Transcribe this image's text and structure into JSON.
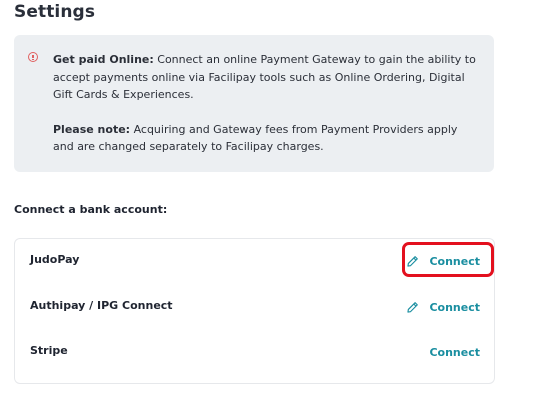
{
  "page": {
    "title": "Settings"
  },
  "info": {
    "line1_bold": "Get paid Online:",
    "line1_text": "Connect an online Payment Gateway to gain the ability to accept payments online via Facilipay tools such as Online Ordering, Digital Gift Cards & Experiences.",
    "line2_bold": "Please note:",
    "line2_text": "Acquiring and Gateway fees from Payment Providers apply and are changed separately to Facilipay charges.",
    "icon": "alert-circle-icon",
    "icon_color": "#e06060"
  },
  "bank": {
    "section_label": "Connect a bank account:",
    "providers": [
      {
        "name": "JudoPay",
        "action": "Connect",
        "icon": "pencil-icon",
        "highlighted": true
      },
      {
        "name": "Authipay / IPG Connect",
        "action": "Connect",
        "icon": "pencil-icon",
        "highlighted": false
      },
      {
        "name": "Stripe",
        "action": "Connect",
        "icon": null,
        "highlighted": false
      }
    ]
  },
  "colors": {
    "accent": "#1a8ea0",
    "highlight": "#e3101e",
    "info_bg": "#eceff2"
  }
}
